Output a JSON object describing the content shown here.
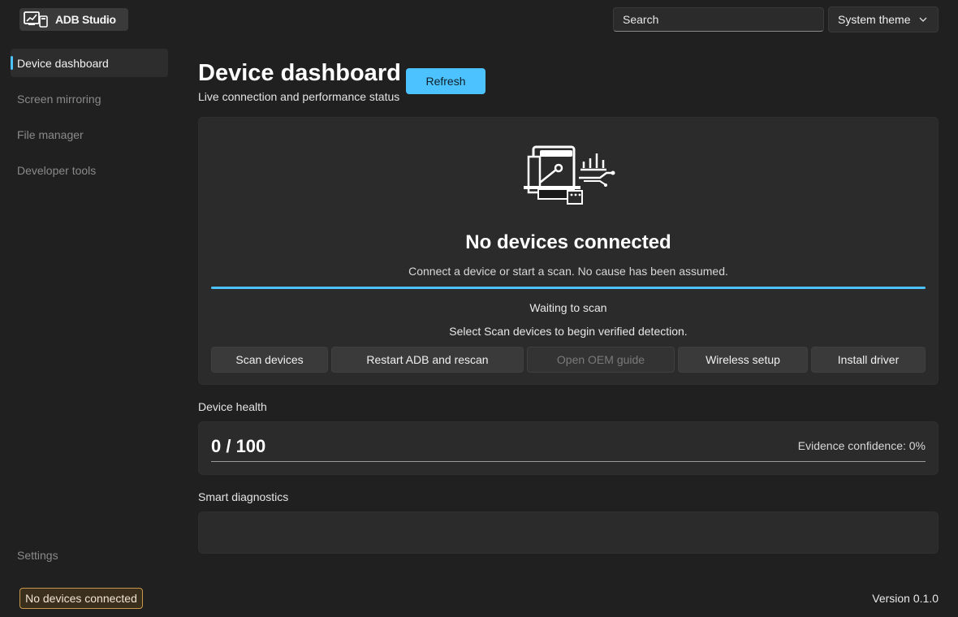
{
  "app": {
    "name": "ADB Studio",
    "version": "Version 0.1.0",
    "connection_badge": "No devices connected"
  },
  "header": {
    "search_placeholder": "Search",
    "theme_value": "System theme"
  },
  "sidebar": {
    "items": [
      {
        "label": "Device dashboard",
        "active": true
      },
      {
        "label": "Screen mirroring",
        "active": false
      },
      {
        "label": "File manager",
        "active": false
      },
      {
        "label": "Developer tools",
        "active": false
      }
    ],
    "settings_label": "Settings"
  },
  "main": {
    "title": "Device dashboard",
    "subtitle": "Live connection and performance status",
    "refresh_label": "Refresh",
    "status": {
      "title": "No devices connected",
      "subtitle": "Connect a device or start a scan. No cause has been assumed.",
      "state": "Waiting to scan",
      "hint": "Select Scan devices to begin verified detection.",
      "actions": [
        {
          "label": "Scan devices",
          "enabled": true
        },
        {
          "label": "Restart ADB and rescan",
          "enabled": true
        },
        {
          "label": "Open OEM guide",
          "enabled": false
        },
        {
          "label": "Wireless setup",
          "enabled": true
        },
        {
          "label": "Install driver",
          "enabled": true
        }
      ]
    },
    "health": {
      "section_label": "Device health",
      "score": "0 / 100",
      "confidence": "Evidence confidence: 0%"
    },
    "diagnostics": {
      "section_label": "Smart diagnostics"
    }
  },
  "colors": {
    "accent": "#4cc2ff",
    "background": "#202020",
    "card": "#2b2b2b",
    "badge_border": "#c9974a"
  },
  "icons": [
    "app-logo-icon",
    "chevron-down-icon",
    "devices-illustration-icon"
  ]
}
